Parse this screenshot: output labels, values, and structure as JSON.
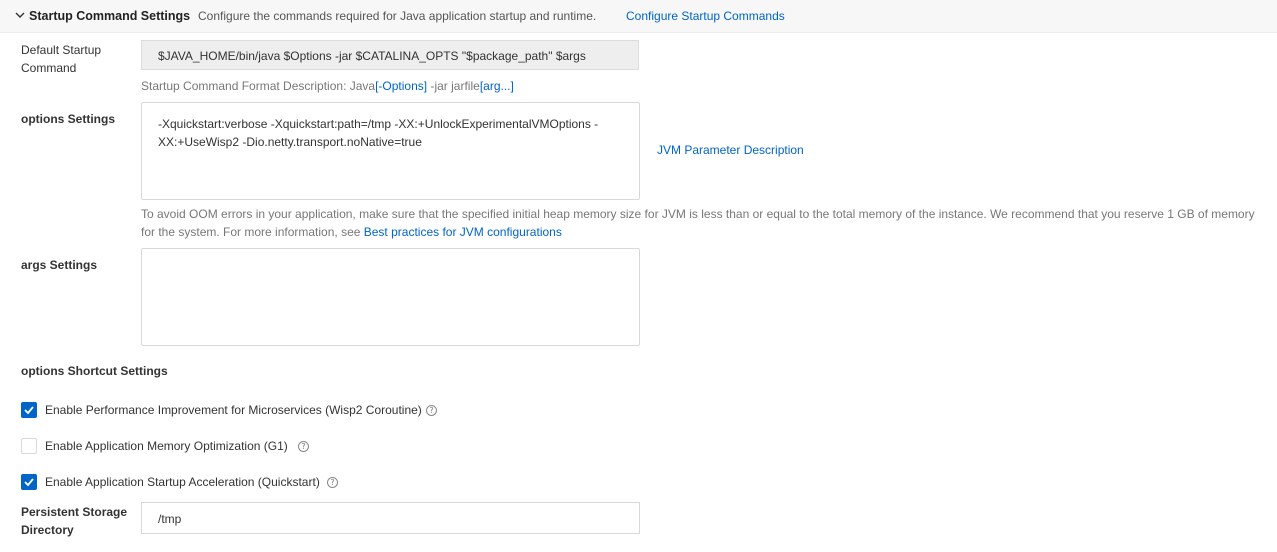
{
  "section": {
    "title": "Startup Command Settings",
    "description": "Configure the commands required for Java application startup and runtime.",
    "configure_link": "Configure Startup Commands",
    "chevron_icon": "chevron-down-icon"
  },
  "default_command": {
    "label_line1": "Default Startup",
    "label_line2": "Command",
    "value": "$JAVA_HOME/bin/java $Options -jar $CATALINA_OPTS \"$package_path\" $args",
    "format_prefix": "Startup Command Format Description: Java",
    "format_options": "[-Options]",
    "format_middle": " -jar jarfile",
    "format_args": "[arg...]"
  },
  "options": {
    "label": "options Settings",
    "value_line1": "-Xquickstart:verbose -Xquickstart:path=/tmp -XX:+UnlockExperimentalVMOptions -",
    "value_line2": "XX:+UseWisp2 -Dio.netty.transport.noNative=true",
    "jvm_link": "JVM Parameter Description",
    "oom_line1": "To avoid OOM errors in your application, make sure that the specified initial heap memory size for JVM is less than or equal to the total memory of the instance. We recommend that you reserve 1 GB of memory",
    "oom_line2_prefix": "for the system. For more information, see ",
    "oom_link": "Best practices for JVM configurations"
  },
  "args": {
    "label": "args Settings",
    "value": ""
  },
  "shortcuts": {
    "title": "options Shortcut Settings",
    "items": [
      {
        "label": "Enable Performance Improvement for Microservices (Wisp2 Coroutine)",
        "checked": true
      },
      {
        "label": "Enable Application Memory Optimization (G1)",
        "checked": false
      },
      {
        "label": "Enable Application Startup Acceleration (Quickstart)",
        "checked": true
      }
    ],
    "help_glyph": "?"
  },
  "storage": {
    "label_line1": "Persistent Storage",
    "label_line2": "Directory",
    "value": "/tmp"
  },
  "colors": {
    "link": "#0064c8",
    "checkbox_on": "#0064c8",
    "header_bg": "#f7f7f7"
  }
}
